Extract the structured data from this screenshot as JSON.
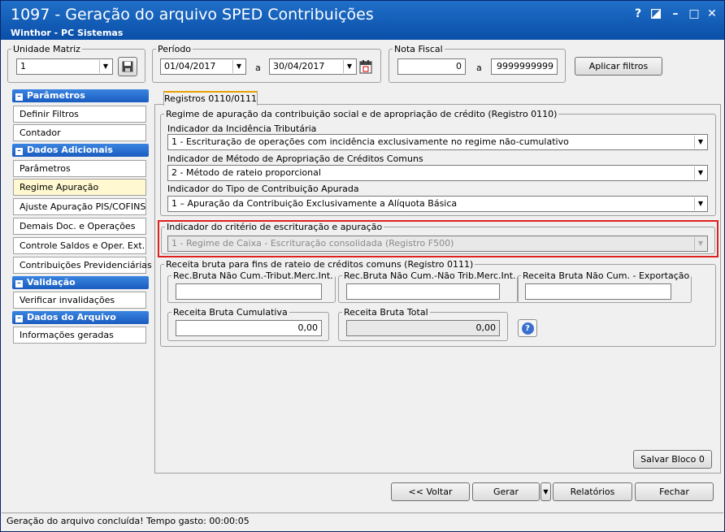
{
  "window": {
    "title": "1097 - Geração do arquivo SPED Contribuições",
    "subtitle": "Winthor - PC Sistemas",
    "help": "?",
    "minimize": "–",
    "maximize": "□",
    "close": "✕"
  },
  "filters": {
    "unidade_label": "Unidade Matriz",
    "unidade_value": "1",
    "periodo_label": "Período",
    "periodo_start": "01/04/2017",
    "periodo_sep": "a",
    "periodo_end": "30/04/2017",
    "nota_label": "Nota Fiscal",
    "nota_start": "0",
    "nota_sep": "a",
    "nota_end": "9999999999",
    "apply_button": "Aplicar filtros"
  },
  "sidebar": {
    "sections": [
      {
        "title": "Parâmetros",
        "items": [
          "Definir Filtros",
          "Contador"
        ]
      },
      {
        "title": "Dados Adicionais",
        "items": [
          "Parâmetros",
          "Regime Apuração",
          "Ajuste Apuração PIS/COFINS",
          "Demais Doc. e Operações",
          "Controle Saldos e Oper. Ext.",
          "Contribuições Previdenciárias"
        ]
      },
      {
        "title": "Validação",
        "items": [
          "Verificar invalidações"
        ]
      },
      {
        "title": "Dados do Arquivo",
        "items": [
          "Informações geradas"
        ]
      }
    ]
  },
  "tab": {
    "label": "Registros 0110/0111"
  },
  "regime": {
    "group_title": "Regime de apuração da contribuição social e de apropriação de crédito (Registro 0110)",
    "incidencia_label": "Indicador da Incidência Tributária",
    "incidencia_value": "1 - Escrituração de operações com incidência exclusivamente no regime não-cumulativo",
    "metodo_label": "Indicador de Método de Apropriação de Créditos Comuns",
    "metodo_value": "2 - Método de rateio proporcional",
    "tipo_label": "Indicador do Tipo de Contribuição Apurada",
    "tipo_value": "1 – Apuração da Contribuição Exclusivamente a Alíquota Básica",
    "criterio_label": "Indicador do critério de escrituração e apuração",
    "criterio_value": "1 - Regime de Caixa - Escrituração consolidada (Registro F500)"
  },
  "receita": {
    "group_title": "Receita bruta para fins de rateio de créditos comuns (Registro 0111)",
    "f1_label": "Rec.Bruta Não Cum.-Tribut.Merc.Int.",
    "f1_value": "",
    "f2_label": "Rec.Bruta Não Cum.-Não Trib.Merc.Int.",
    "f2_value": "",
    "f3_label": "Receita Bruta Não Cum. - Exportação",
    "f3_value": "",
    "f4_label": "Receita Bruta Cumulativa",
    "f4_value": "0,00",
    "f5_label": "Receita Bruta Total",
    "f5_value": "0,00",
    "help": "?"
  },
  "buttons": {
    "salvar": "Salvar Bloco 0",
    "voltar": "<< Voltar",
    "gerar": "Gerar",
    "relatorios": "Relatórios",
    "fechar": "Fechar"
  },
  "status": {
    "text": "Geração do arquivo concluída! Tempo gasto: 00:00:05"
  },
  "colors": {
    "title_bar": "#0a4fa8",
    "section": "#1a5cc0",
    "highlight": "#e02020"
  }
}
